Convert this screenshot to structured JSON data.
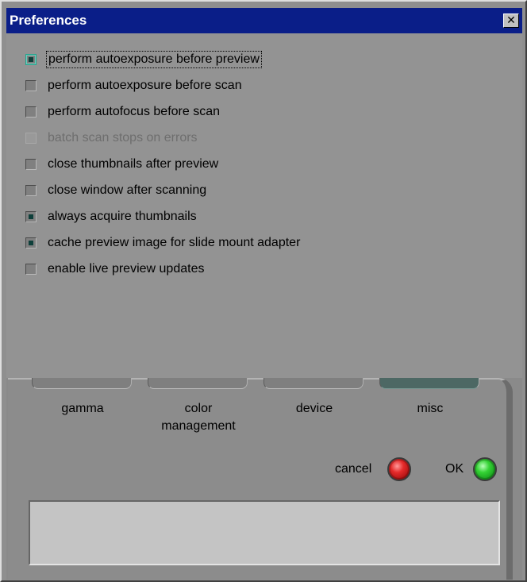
{
  "window": {
    "title": "Preferences",
    "close_glyph": "✕"
  },
  "options": [
    {
      "label": "perform autoexposure before preview",
      "checked": true,
      "disabled": false,
      "focused": true
    },
    {
      "label": "perform autoexposure before scan",
      "checked": false,
      "disabled": false,
      "focused": false
    },
    {
      "label": "perform autofocus before scan",
      "checked": false,
      "disabled": false,
      "focused": false
    },
    {
      "label": "batch scan stops on errors",
      "checked": false,
      "disabled": true,
      "focused": false
    },
    {
      "label": "close thumbnails after preview",
      "checked": false,
      "disabled": false,
      "focused": false
    },
    {
      "label": "close window after scanning",
      "checked": false,
      "disabled": false,
      "focused": false
    },
    {
      "label": "always acquire thumbnails",
      "checked": true,
      "disabled": false,
      "focused": false
    },
    {
      "label": "cache preview image for slide mount adapter",
      "checked": true,
      "disabled": false,
      "focused": false
    },
    {
      "label": "enable live preview updates",
      "checked": false,
      "disabled": false,
      "focused": false
    }
  ],
  "tabs": [
    {
      "label": "gamma",
      "label2": "",
      "active": false
    },
    {
      "label": "color",
      "label2": "management",
      "active": false
    },
    {
      "label": "device",
      "label2": "",
      "active": false
    },
    {
      "label": "misc",
      "label2": "",
      "active": true
    }
  ],
  "actions": {
    "cancel_label": "cancel",
    "ok_label": "OK",
    "cancel_icon": "red-round-button-icon",
    "ok_icon": "green-round-button-icon"
  },
  "status": {
    "text": ""
  },
  "colors": {
    "titlebar": "#0a1e88",
    "background": "#939393",
    "active_tab": "#4d6864",
    "cancel": "#e52a2a",
    "ok": "#34d234"
  }
}
